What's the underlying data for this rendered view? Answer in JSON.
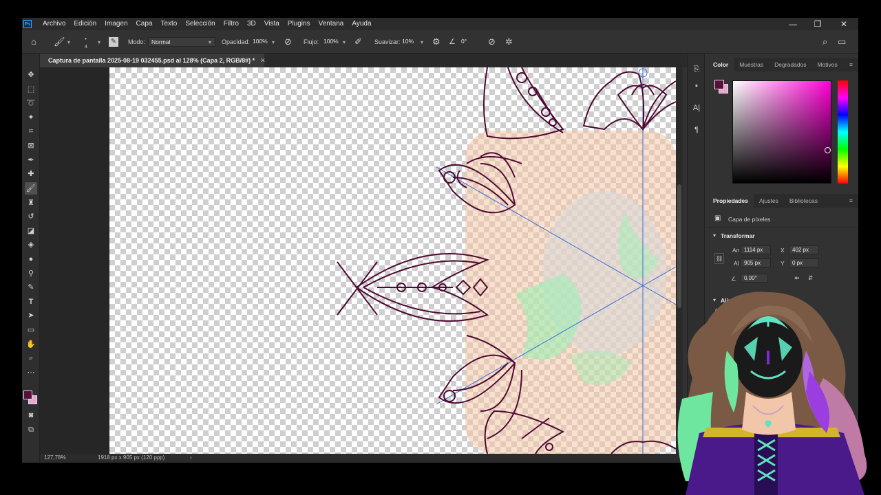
{
  "menu": {
    "logo": "Ps",
    "items": [
      "Archivo",
      "Edición",
      "Imagen",
      "Capa",
      "Texto",
      "Selección",
      "Filtro",
      "3D",
      "Vista",
      "Plugins",
      "Ventana",
      "Ayuda"
    ]
  },
  "window_controls": {
    "minimize": "—",
    "restore": "❐",
    "close": "✕"
  },
  "options": {
    "mode_label": "Modo:",
    "mode_value": "Normal",
    "opacity_label": "Opacidad:",
    "opacity_value": "100%",
    "flow_label": "Flujo:",
    "flow_value": "100%",
    "smooth_label": "Suavizar:",
    "smooth_value": "10%",
    "angle_value": "0°",
    "brush_size": "4"
  },
  "document": {
    "tab_title": "Captura de pantalla 2025-08-19 032455.psd al 128% (Capa 2, RGB/8#) *",
    "zoom": "127,78%",
    "dimensions": "1918 px x 905 px (120 ppp)"
  },
  "color_panel": {
    "tabs": [
      "Color",
      "Muestras",
      "Degradados",
      "Motivos"
    ],
    "foreground": "#5a0f3a",
    "background": "#e9a5d4"
  },
  "properties_panel": {
    "tabs": [
      "Propiedades",
      "Ajustes",
      "Bibliotecas"
    ],
    "layer_type": "Capa de píxeles",
    "transform_heading": "Transformar",
    "an_label": "An",
    "an_value": "1114 px",
    "x_label": "X",
    "x_value": "402 px",
    "al_label": "Al",
    "al_value": "905 px",
    "y_label": "Y",
    "y_value": "0 px",
    "angle_value": "0,00°",
    "align_heading": "Alinear",
    "align_sub": "Alin"
  },
  "colors": {
    "stroke": "#4f0a33",
    "guide": "#3b6fd8",
    "peach": "#f6c7a6",
    "mint": "#9ff0b4"
  }
}
